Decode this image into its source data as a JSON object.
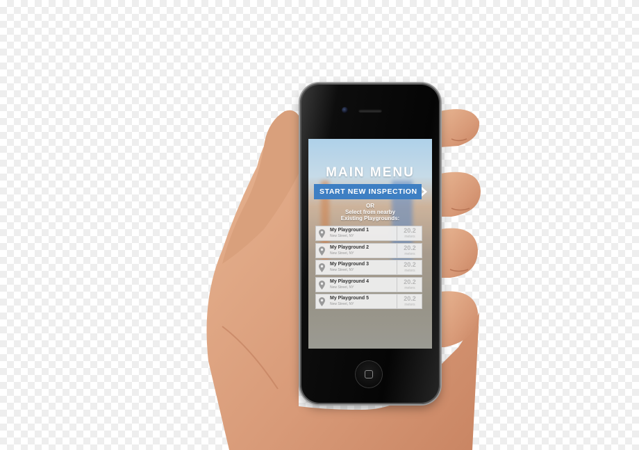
{
  "app": {
    "title": "MAIN MENU",
    "start_button_label": "START NEW INSPECTION",
    "or_label": "OR",
    "select_label_line1": "Select from nearby",
    "select_label_line2": "Existing Playgrounds:"
  },
  "playgrounds": [
    {
      "name": "My Playground 1",
      "street": "New Street, NY",
      "distance": "20.2",
      "unit": "meters"
    },
    {
      "name": "My Playground 2",
      "street": "New Street, NY",
      "distance": "20.2",
      "unit": "meters"
    },
    {
      "name": "My Playground 3",
      "street": "New Street, NY",
      "distance": "20.2",
      "unit": "meters"
    },
    {
      "name": "My Playground 4",
      "street": "New Street, NY",
      "distance": "20.2",
      "unit": "meters"
    },
    {
      "name": "My Playground 5",
      "street": "New Street, NY",
      "distance": "20.2",
      "unit": "meters"
    }
  ],
  "colors": {
    "accent": "#3e7fc3",
    "list_bg": "#eeeeee",
    "title_text": "#ffffff"
  },
  "icons": {
    "pin": "map-pin-icon",
    "chevron": "chevron-right-icon",
    "home": "home-button-icon"
  }
}
